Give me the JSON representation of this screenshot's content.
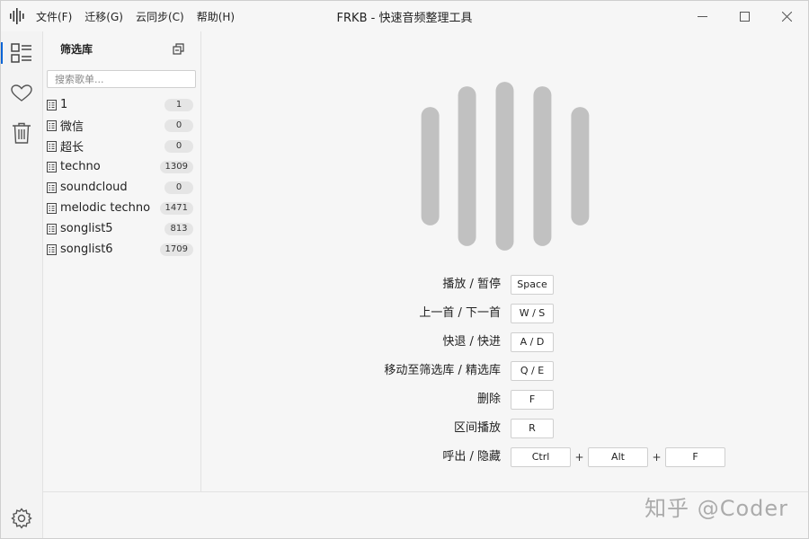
{
  "window": {
    "title": "FRKB - 快速音频整理工具",
    "menu": [
      "文件(F)",
      "迁移(G)",
      "云同步(C)",
      "帮助(H)"
    ]
  },
  "sidebar": {
    "title": "筛选库",
    "search_placeholder": "搜索歌单...",
    "playlists": [
      {
        "name": "1",
        "count": "1"
      },
      {
        "name": "微信",
        "count": "0"
      },
      {
        "name": "超长",
        "count": "0"
      },
      {
        "name": "techno",
        "count": "1309"
      },
      {
        "name": "soundcloud",
        "count": "0"
      },
      {
        "name": "melodic techno",
        "count": "1471"
      },
      {
        "name": "songlist5",
        "count": "813"
      },
      {
        "name": "songlist6",
        "count": "1709"
      }
    ]
  },
  "rail": {
    "icons": [
      "playlist-icon",
      "heart-icon",
      "trash-icon",
      "settings-icon"
    ]
  },
  "shortcuts": [
    {
      "label": "播放 / 暂停",
      "keys": [
        "Space"
      ]
    },
    {
      "label": "上一首 / 下一首",
      "keys": [
        "W / S"
      ]
    },
    {
      "label": "快退 / 快进",
      "keys": [
        "A / D"
      ]
    },
    {
      "label": "移动至筛选库 / 精选库",
      "keys": [
        "Q / E"
      ]
    },
    {
      "label": "删除",
      "keys": [
        "F"
      ]
    },
    {
      "label": "区间播放",
      "keys": [
        "R"
      ]
    },
    {
      "label": "呼出 / 隐藏",
      "keys": [
        "Ctrl",
        "Alt",
        "F"
      ],
      "separator": "+"
    }
  ],
  "watermark": "知乎 @Coder",
  "colors": {
    "accent": "#0a64d6",
    "wave": "#c1c1c1"
  }
}
